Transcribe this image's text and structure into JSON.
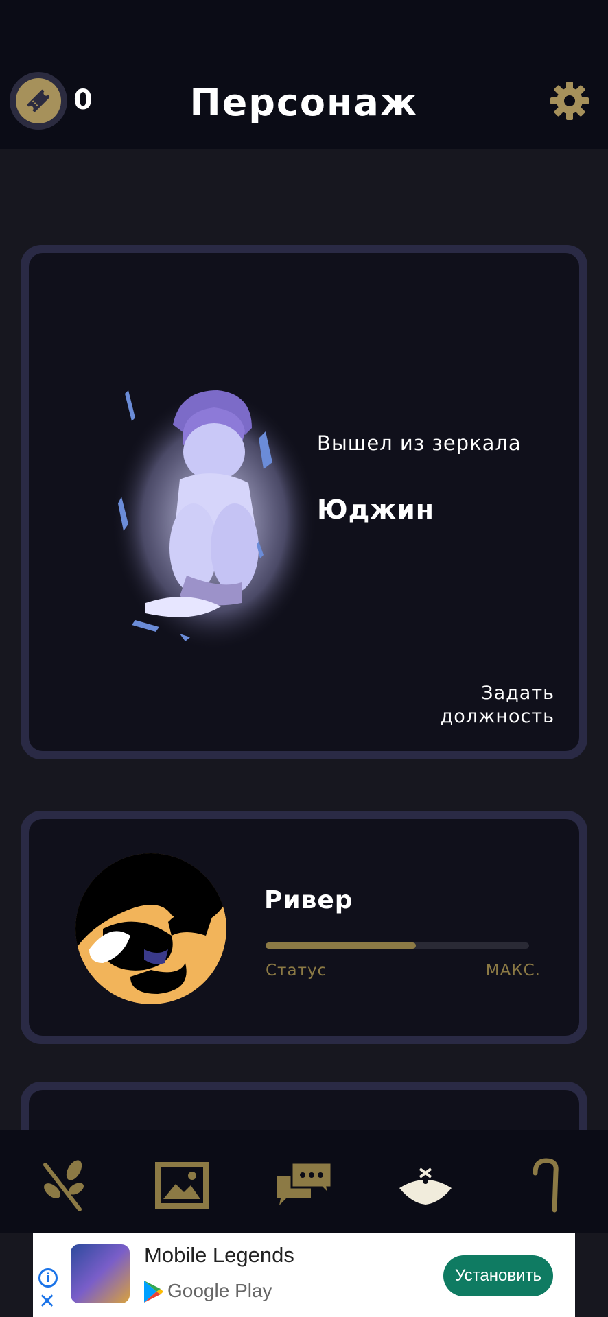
{
  "header": {
    "ticket_count": "0",
    "title": "Персонаж"
  },
  "main_card": {
    "origin": "Вышел из зеркала",
    "name": "Юджин",
    "assign_label": "Задать должность"
  },
  "river_card": {
    "name": "Ривер",
    "status_label": "Статус",
    "max_label": "МАКС.",
    "progress": 0.57
  },
  "nav": {
    "items": [
      "branch-icon",
      "gallery-icon",
      "chat-icon",
      "hat-icon",
      "cane-icon"
    ],
    "accent": "#8c7a45"
  },
  "ad": {
    "title": "Mobile Legends",
    "store": "Google Play",
    "install_label": "Установить",
    "info_glyph": "i",
    "close_glyph": "✕"
  },
  "colors": {
    "background": "#17171f",
    "header": "#0b0c16",
    "card_border": "#2a2a45",
    "gold": "#a6915b"
  }
}
